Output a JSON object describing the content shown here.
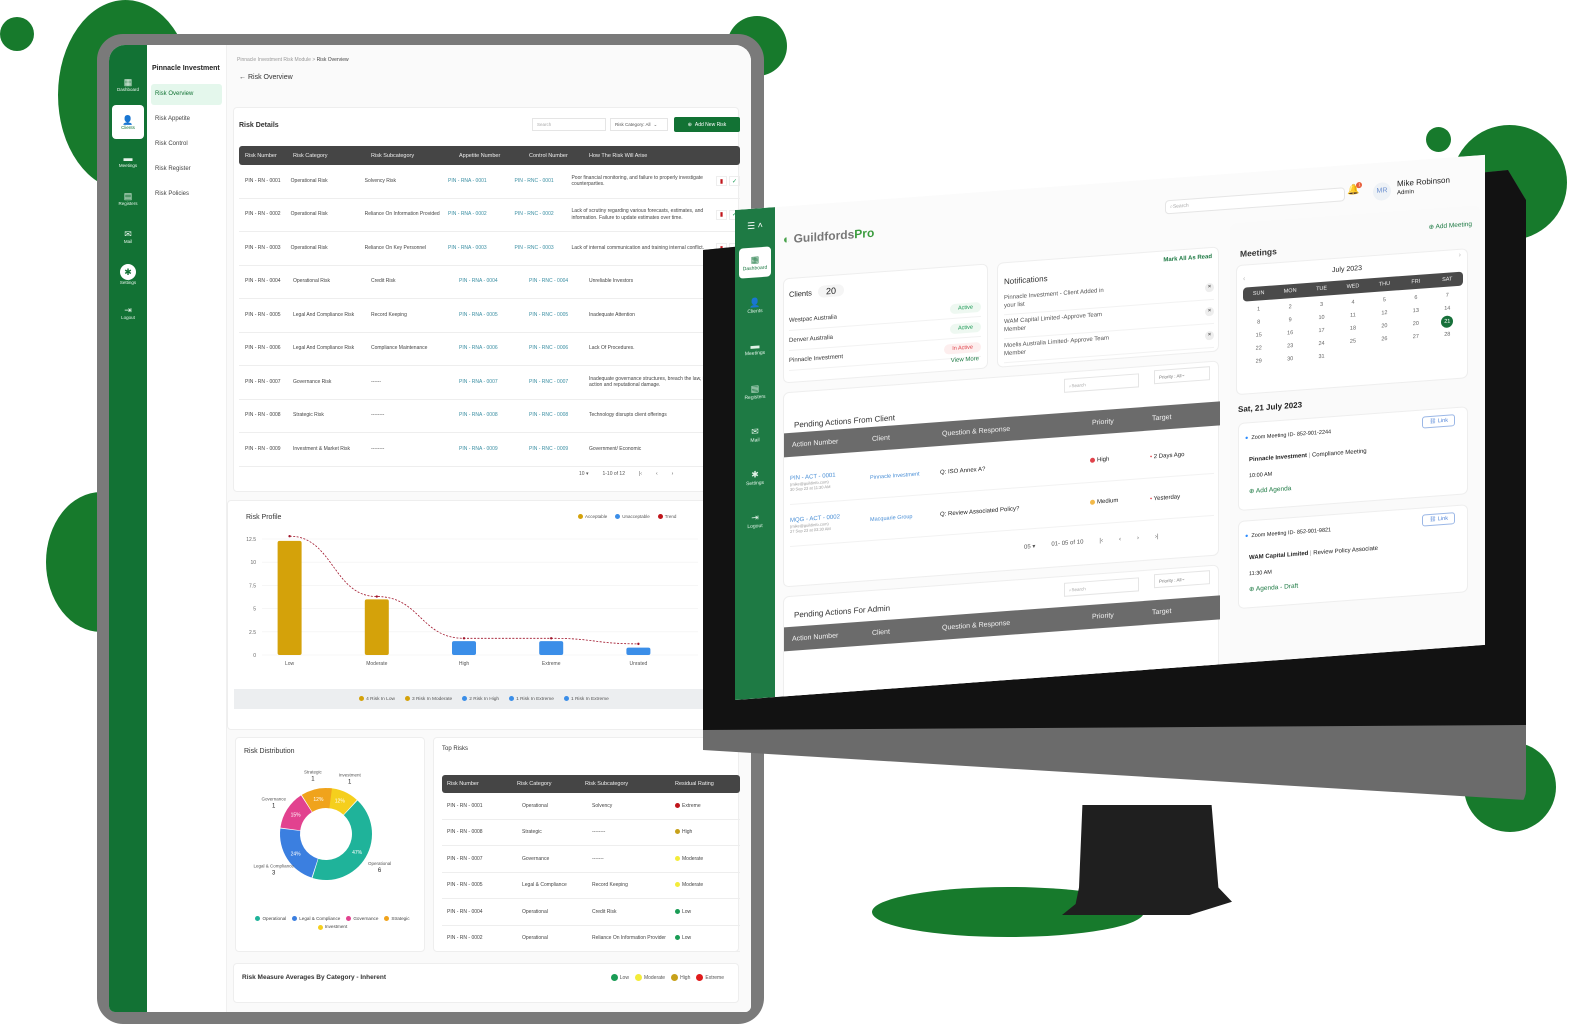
{
  "tablet": {
    "rail": [
      {
        "icon": "dashboard-icon",
        "label": "Dashboard",
        "glyph": "▦"
      },
      {
        "icon": "clients-icon",
        "label": "Clients",
        "glyph": "👤",
        "active": true
      },
      {
        "icon": "meetings-icon",
        "label": "Meetings",
        "glyph": "▬"
      },
      {
        "icon": "registers-icon",
        "label": "Registers",
        "glyph": "▤"
      },
      {
        "icon": "mail-icon",
        "label": "Mail",
        "glyph": "✉"
      },
      {
        "icon": "settings-icon",
        "label": "Settings",
        "glyph": "✱"
      },
      {
        "icon": "logout-icon",
        "label": "Logout",
        "glyph": "⇥"
      }
    ],
    "org_name": "Pinnacle Investment",
    "submenu": [
      "Risk Overview",
      "Risk Appetite",
      "Risk Control",
      "Risk Register",
      "Risk Policies"
    ],
    "breadcrumb": {
      "parent": "Pinnacle Investment Risk Module",
      "sep": ">",
      "current": "Risk Overview"
    },
    "back_label": "Risk Overview",
    "risk_details": {
      "title": "Risk Details",
      "search_placeholder": "Search",
      "filter": "Risk Category: All",
      "add_button": "Add New Risk",
      "columns": [
        "Risk Number",
        "Risk Category",
        "Risk Subcategory",
        "Appetite Number",
        "Control Number",
        "How The Risk Will Arise"
      ],
      "rows": [
        [
          "PIN - RN - 0001",
          "Operational Risk",
          "Solvency Risk",
          "PIN - RNA - 0001",
          "PIN - RNC - 0001",
          "Poor financial monitoring, and failure to properly investigate counterparties."
        ],
        [
          "PIN - RN - 0002",
          "Operational Risk",
          "Reliance On Information Provided",
          "PIN - RNA - 0002",
          "PIN - RNC - 0002",
          "Lack of scrutiny regarding various forecasts, estimates, and information. Failure to update estimates over time."
        ],
        [
          "PIN - RN - 0003",
          "Operational Risk",
          "Reliance On Key Personnel",
          "PIN - RNA - 0003",
          "PIN - RNC - 0003",
          "Lack of internal communication and training internal conflict."
        ],
        [
          "PIN - RN - 0004",
          "Operational Risk",
          "Credit Risk",
          "PIN - RNA - 0004",
          "PIN - RNC - 0004",
          "Unreliable Investors"
        ],
        [
          "PIN - RN - 0005",
          "Legal And Compliance Risk",
          "Record Keeping",
          "PIN - RNA - 0005",
          "PIN - RNC - 0005",
          "Inadequate Attention"
        ],
        [
          "PIN - RN - 0006",
          "Legal And Compliance Risk",
          "Compliance Maintenance",
          "PIN - RNA - 0006",
          "PIN - RNC - 0006",
          "Lack Of Procedures."
        ],
        [
          "PIN - RN - 0007",
          "Governance Risk",
          "------",
          "PIN - RNA - 0007",
          "PIN - RNC - 0007",
          "Inadequate governance structures, breach the law, incur regulatory action and reputational damage."
        ],
        [
          "PIN - RN - 0008",
          "Strategic Risk",
          "--------",
          "PIN - RNA - 0008",
          "PIN - RNC - 0008",
          "Technology disrupts client offerings"
        ],
        [
          "PIN - RN - 0009",
          "Investment & Market Risk",
          "--------",
          "PIN - RNA - 0009",
          "PIN - RNC - 0009",
          "Government/ Economic"
        ]
      ],
      "pagination": {
        "per_page": "10",
        "range": "1-10 of 12"
      }
    },
    "risk_profile": {
      "title": "Risk Profile",
      "legend": [
        {
          "label": "Acceptable",
          "color": "#d4a20a"
        },
        {
          "label": "Unacceptable",
          "color": "#3b8ee8"
        },
        {
          "label": "Trend",
          "color": "#c0151b"
        }
      ],
      "footer_legend": [
        {
          "label": "4 Risk In Low",
          "color": "#d4a20a"
        },
        {
          "label": "3 Risk In Moderate",
          "color": "#d4a20a"
        },
        {
          "label": "2 Risk In High",
          "color": "#3b8ee8"
        },
        {
          "label": "1 Risk In Extreme",
          "color": "#3b8ee8"
        },
        {
          "label": "1 Risk In Extreme",
          "color": "#3b8ee8"
        }
      ]
    },
    "risk_distribution": {
      "title": "Risk Distribution",
      "slices": [
        {
          "label": "Operational",
          "value": 6,
          "pct": "47%",
          "color": "#1fb39a"
        },
        {
          "label": "Legal & Compliance",
          "value": 3,
          "pct": "24%",
          "color": "#3b7fe0"
        },
        {
          "label": "Governance",
          "value": 1,
          "pct": "15%",
          "color": "#e2428f"
        },
        {
          "label": "Strategic",
          "value": 1,
          "pct": "12%",
          "color": "#f0a31c"
        },
        {
          "label": "Investment",
          "value": 1,
          "pct": "12%",
          "color": "#f5cf1d"
        }
      ]
    },
    "top_risks": {
      "title": "Top Risks",
      "columns": [
        "Risk Number",
        "Risk Category",
        "Risk Subcategory",
        "Residual Rating"
      ],
      "rows": [
        {
          "num": "PIN - RN - 0001",
          "cat": "Operational",
          "sub": "Solvency",
          "rating": "Extreme",
          "color": "#c0151b"
        },
        {
          "num": "PIN - RN - 0008",
          "cat": "Strategic",
          "sub": "--------",
          "rating": "High",
          "color": "#c7a11a"
        },
        {
          "num": "PIN - RN - 0007",
          "cat": "Governance",
          "sub": "-------",
          "rating": "Moderate",
          "color": "#f3ec3a"
        },
        {
          "num": "PIN - RN - 0005",
          "cat": "Legal & Compliance",
          "sub": "Record Keeping",
          "rating": "Moderate",
          "color": "#f3ec3a"
        },
        {
          "num": "PIN - RN - 0004",
          "cat": "Operational",
          "sub": "Credit Risk",
          "rating": "Low",
          "color": "#1a9c55"
        },
        {
          "num": "PIN - RN - 0002",
          "cat": "Operational",
          "sub": "Reliance On Information Provider",
          "rating": "Low",
          "color": "#1a9c55"
        }
      ]
    },
    "averages": {
      "title": "Risk Measure Averages By Category - Inherent",
      "legend": [
        {
          "label": "Low",
          "color": "#1a9c55"
        },
        {
          "label": "Moderate",
          "color": "#f3ec3a"
        },
        {
          "label": "High",
          "color": "#c7a11a"
        },
        {
          "label": "Extreme",
          "color": "#e01b1b"
        }
      ]
    }
  },
  "chart_data": {
    "type": "bar",
    "title": "Risk Profile",
    "categories": [
      "Low",
      "Moderate",
      "High",
      "Extreme",
      "Unrated"
    ],
    "values": [
      12.3,
      6.0,
      1.5,
      1.5,
      0.8
    ],
    "colors": [
      "#d4a20a",
      "#d4a20a",
      "#3b8ee8",
      "#3b8ee8",
      "#3b8ee8"
    ],
    "trend": [
      12.8,
      6.3,
      1.8,
      1.8,
      1.2
    ],
    "ylim": [
      0,
      12.5
    ],
    "yticks": [
      "0",
      "2.5",
      "5",
      "7.5",
      "10",
      "12.5"
    ],
    "xlabel": "",
    "ylabel": "",
    "grid": true,
    "legend": "top-right"
  },
  "monitor": {
    "brand": {
      "name_a": "Guildfords",
      "name_b": "Pro"
    },
    "rail": [
      {
        "icon": "dashboard-icon",
        "label": "Dashboard",
        "glyph": "▦",
        "active": true
      },
      {
        "icon": "clients-icon",
        "label": "Clients",
        "glyph": "👤"
      },
      {
        "icon": "meetings-icon",
        "label": "Meetings",
        "glyph": "▬"
      },
      {
        "icon": "registers-icon",
        "label": "Registers",
        "glyph": "▤"
      },
      {
        "icon": "mail-icon",
        "label": "Mail",
        "glyph": "✉"
      },
      {
        "icon": "settings-icon",
        "label": "Settings",
        "glyph": "✱"
      },
      {
        "icon": "logout-icon",
        "label": "Logout",
        "glyph": "⇥"
      }
    ],
    "search_placeholder": "Search",
    "user": {
      "initials": "MR",
      "name": "Mike Robinson",
      "role": "Admin",
      "notif_count": "1"
    },
    "clients": {
      "title": "Clients",
      "count": "20",
      "rows": [
        {
          "name": "Westpac Australia",
          "status": "Active",
          "color": "#1e9a57"
        },
        {
          "name": "Denver Australia",
          "status": "Active",
          "color": "#1e9a57"
        },
        {
          "name": "Pinnacle Investment",
          "status": "In Active",
          "color": "#e0434b"
        }
      ],
      "view_more": "View More"
    },
    "notifications": {
      "title": "Notifications",
      "mark_all": "Mark All As Read",
      "items": [
        "Pinnacle Investment - Client Added in your list",
        "WAM Capital Limited -Approve Team Member",
        "Moelis Australia Limited- Approve Team Member"
      ]
    },
    "pending_client": {
      "title": "Pending Actions From Client",
      "search_placeholder": "Search",
      "filter": "Priority : All",
      "columns": [
        "Action Number",
        "Client",
        "Question & Response",
        "Priority",
        "Target"
      ],
      "rows": [
        {
          "num": "PIN - ACT - 0001",
          "email": "(mike@guildinfo.com)",
          "date": "30 Sep 23 at 11:30 AM",
          "client": "Pinnacle Investment",
          "q": "Q: ISO Annex A?",
          "priority": "High",
          "pcolor": "#e0434b",
          "target": "2 Days Ago"
        },
        {
          "num": "MQG - ACT - 0002",
          "email": "(mike@guildinfo.com)",
          "date": "27 Sep 23 at 03:30 AM",
          "client": "Macquarie Group",
          "q": "Q: Review Associated Policy?",
          "priority": "Medium",
          "pcolor": "#f2b94a",
          "target": "Yesterday"
        }
      ],
      "pagination": {
        "per_page": "05",
        "range": "01- 05 of 10"
      }
    },
    "pending_admin": {
      "title": "Pending Actions For Admin",
      "search_placeholder": "Search",
      "filter": "Priority : All",
      "columns": [
        "Action Number",
        "Client",
        "Question & Response",
        "Priority",
        "Target"
      ]
    },
    "meetings": {
      "title": "Meetings",
      "add": "Add Meeting",
      "month": "July 2023",
      "weekdays": [
        "SUN",
        "MON",
        "TUE",
        "WED",
        "THU",
        "FRI",
        "SAT"
      ],
      "days": [
        "",
        "",
        "",
        "",
        "",
        "",
        "",
        "1",
        "2",
        "3",
        "4",
        "5",
        "6",
        "7",
        "8",
        "9",
        "10",
        "11",
        "12",
        "13",
        "14",
        "15",
        "16",
        "17",
        "18",
        "20",
        "20",
        "21",
        "22",
        "23",
        "24",
        "25",
        "26",
        "27",
        "28",
        "29",
        "30",
        "31",
        "",
        "",
        "",
        ""
      ],
      "selected": "21",
      "date_heading": "Sat, 21 July 2023",
      "items": [
        {
          "zoom": "Zoom Meeting ID- 852-901-2244",
          "link": "Link",
          "client": "Pinnacle Investment",
          "type": "Compliance Meeting",
          "time": "10:00 AM",
          "action": "Add Agenda"
        },
        {
          "zoom": "Zoom Meeting ID- 852-901-9821",
          "link": "Link",
          "client": "WAM Capital Limited",
          "type": "Review Policy  Associate",
          "time": "11:30 AM",
          "action": "Agenda - Draft"
        }
      ]
    }
  }
}
